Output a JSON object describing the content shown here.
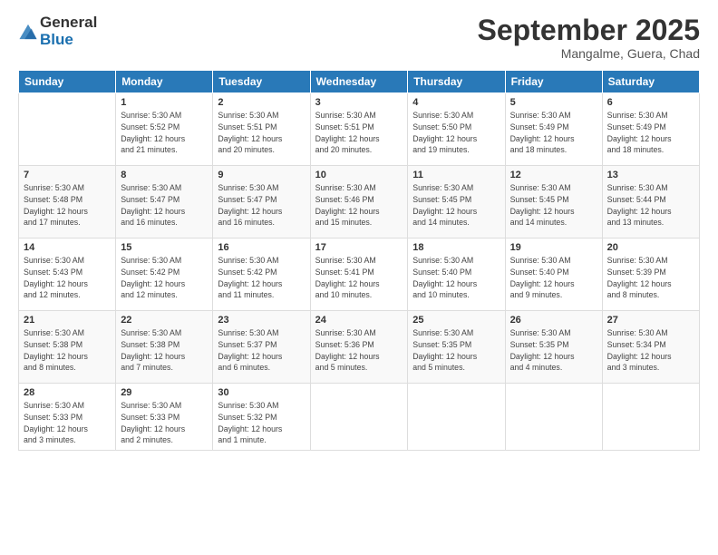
{
  "logo": {
    "general": "General",
    "blue": "Blue"
  },
  "header": {
    "month": "September 2025",
    "location": "Mangalme, Guera, Chad"
  },
  "weekdays": [
    "Sunday",
    "Monday",
    "Tuesday",
    "Wednesday",
    "Thursday",
    "Friday",
    "Saturday"
  ],
  "weeks": [
    [
      {
        "day": "",
        "info": ""
      },
      {
        "day": "1",
        "info": "Sunrise: 5:30 AM\nSunset: 5:52 PM\nDaylight: 12 hours\nand 21 minutes."
      },
      {
        "day": "2",
        "info": "Sunrise: 5:30 AM\nSunset: 5:51 PM\nDaylight: 12 hours\nand 20 minutes."
      },
      {
        "day": "3",
        "info": "Sunrise: 5:30 AM\nSunset: 5:51 PM\nDaylight: 12 hours\nand 20 minutes."
      },
      {
        "day": "4",
        "info": "Sunrise: 5:30 AM\nSunset: 5:50 PM\nDaylight: 12 hours\nand 19 minutes."
      },
      {
        "day": "5",
        "info": "Sunrise: 5:30 AM\nSunset: 5:49 PM\nDaylight: 12 hours\nand 18 minutes."
      },
      {
        "day": "6",
        "info": "Sunrise: 5:30 AM\nSunset: 5:49 PM\nDaylight: 12 hours\nand 18 minutes."
      }
    ],
    [
      {
        "day": "7",
        "info": "Sunrise: 5:30 AM\nSunset: 5:48 PM\nDaylight: 12 hours\nand 17 minutes."
      },
      {
        "day": "8",
        "info": "Sunrise: 5:30 AM\nSunset: 5:47 PM\nDaylight: 12 hours\nand 16 minutes."
      },
      {
        "day": "9",
        "info": "Sunrise: 5:30 AM\nSunset: 5:47 PM\nDaylight: 12 hours\nand 16 minutes."
      },
      {
        "day": "10",
        "info": "Sunrise: 5:30 AM\nSunset: 5:46 PM\nDaylight: 12 hours\nand 15 minutes."
      },
      {
        "day": "11",
        "info": "Sunrise: 5:30 AM\nSunset: 5:45 PM\nDaylight: 12 hours\nand 14 minutes."
      },
      {
        "day": "12",
        "info": "Sunrise: 5:30 AM\nSunset: 5:45 PM\nDaylight: 12 hours\nand 14 minutes."
      },
      {
        "day": "13",
        "info": "Sunrise: 5:30 AM\nSunset: 5:44 PM\nDaylight: 12 hours\nand 13 minutes."
      }
    ],
    [
      {
        "day": "14",
        "info": "Sunrise: 5:30 AM\nSunset: 5:43 PM\nDaylight: 12 hours\nand 12 minutes."
      },
      {
        "day": "15",
        "info": "Sunrise: 5:30 AM\nSunset: 5:42 PM\nDaylight: 12 hours\nand 12 minutes."
      },
      {
        "day": "16",
        "info": "Sunrise: 5:30 AM\nSunset: 5:42 PM\nDaylight: 12 hours\nand 11 minutes."
      },
      {
        "day": "17",
        "info": "Sunrise: 5:30 AM\nSunset: 5:41 PM\nDaylight: 12 hours\nand 10 minutes."
      },
      {
        "day": "18",
        "info": "Sunrise: 5:30 AM\nSunset: 5:40 PM\nDaylight: 12 hours\nand 10 minutes."
      },
      {
        "day": "19",
        "info": "Sunrise: 5:30 AM\nSunset: 5:40 PM\nDaylight: 12 hours\nand 9 minutes."
      },
      {
        "day": "20",
        "info": "Sunrise: 5:30 AM\nSunset: 5:39 PM\nDaylight: 12 hours\nand 8 minutes."
      }
    ],
    [
      {
        "day": "21",
        "info": "Sunrise: 5:30 AM\nSunset: 5:38 PM\nDaylight: 12 hours\nand 8 minutes."
      },
      {
        "day": "22",
        "info": "Sunrise: 5:30 AM\nSunset: 5:38 PM\nDaylight: 12 hours\nand 7 minutes."
      },
      {
        "day": "23",
        "info": "Sunrise: 5:30 AM\nSunset: 5:37 PM\nDaylight: 12 hours\nand 6 minutes."
      },
      {
        "day": "24",
        "info": "Sunrise: 5:30 AM\nSunset: 5:36 PM\nDaylight: 12 hours\nand 5 minutes."
      },
      {
        "day": "25",
        "info": "Sunrise: 5:30 AM\nSunset: 5:35 PM\nDaylight: 12 hours\nand 5 minutes."
      },
      {
        "day": "26",
        "info": "Sunrise: 5:30 AM\nSunset: 5:35 PM\nDaylight: 12 hours\nand 4 minutes."
      },
      {
        "day": "27",
        "info": "Sunrise: 5:30 AM\nSunset: 5:34 PM\nDaylight: 12 hours\nand 3 minutes."
      }
    ],
    [
      {
        "day": "28",
        "info": "Sunrise: 5:30 AM\nSunset: 5:33 PM\nDaylight: 12 hours\nand 3 minutes."
      },
      {
        "day": "29",
        "info": "Sunrise: 5:30 AM\nSunset: 5:33 PM\nDaylight: 12 hours\nand 2 minutes."
      },
      {
        "day": "30",
        "info": "Sunrise: 5:30 AM\nSunset: 5:32 PM\nDaylight: 12 hours\nand 1 minute."
      },
      {
        "day": "",
        "info": ""
      },
      {
        "day": "",
        "info": ""
      },
      {
        "day": "",
        "info": ""
      },
      {
        "day": "",
        "info": ""
      }
    ]
  ]
}
